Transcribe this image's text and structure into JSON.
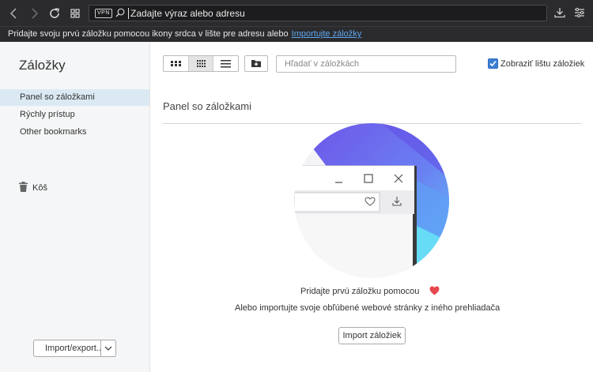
{
  "toolbar": {
    "vpn_label": "VPN",
    "address_placeholder": "Zadajte výraz alebo adresu"
  },
  "infobar": {
    "text": "Pridajte svoju prvú záložku pomocou ikony srdca v lište pre adresu alebo",
    "link": "Importujte záložky"
  },
  "sidebar": {
    "title": "Záložky",
    "items": [
      {
        "label": "Panel so záložkami",
        "selected": true
      },
      {
        "label": "Rýchly prístup"
      },
      {
        "label": "Other bookmarks"
      }
    ],
    "trash_label": "Kôš",
    "import_export_label": "Import/export..."
  },
  "main": {
    "search_placeholder": "Hľadať v záložkách",
    "show_bar_label": "Zobraziť lištu záložiek",
    "show_bar_checked": true,
    "section_title": "Panel so záložkami",
    "empty_title": "Pridajte prvú záložku pomocou",
    "empty_subtitle": "Alebo importujte svoje obľúbené webové stránky z iného prehliadača",
    "import_button": "Import záložiek"
  },
  "colors": {
    "accent": "#3b7fd4",
    "heart": "#e5484d",
    "link": "#5fa8f0"
  }
}
